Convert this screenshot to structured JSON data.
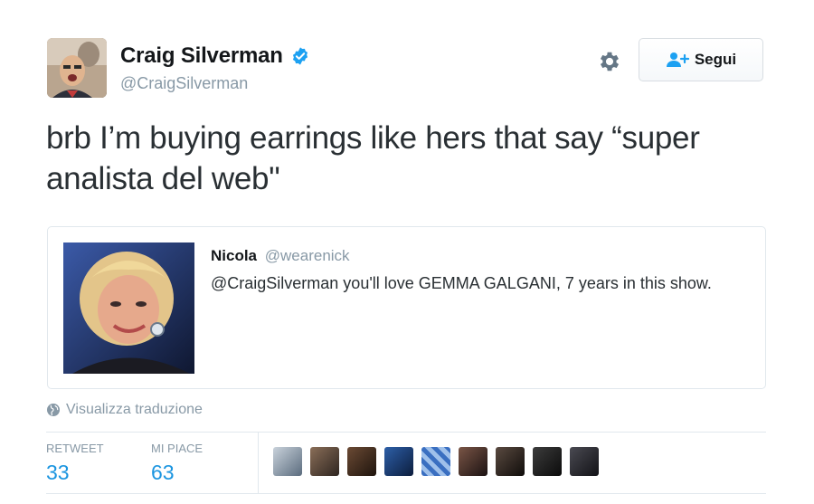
{
  "author": {
    "name": "Craig Silverman",
    "handle": "@CraigSilverman",
    "verified": true,
    "avatar_icon": "author-avatar"
  },
  "actions": {
    "settings_icon": "gear-icon",
    "follow_label": "Segui",
    "follow_icon": "person-add-icon"
  },
  "tweet": {
    "text": "brb I’m buying earrings like hers that say “super analista del web\""
  },
  "quote": {
    "name": "Nicola",
    "handle": "@wearenick",
    "text": "@CraigSilverman you'll love GEMMA GALGANI, 7 years in this show."
  },
  "translate": {
    "label": "Visualizza traduzione",
    "icon": "globe-icon"
  },
  "stats": {
    "retweet_label": "RETWEET",
    "retweet_count": "33",
    "like_label": "MI PIACE",
    "like_count": "63",
    "liker_count": 9
  },
  "colors": {
    "link_blue": "#1b95e0",
    "verified_blue": "#1da1f2",
    "muted_gray": "#8899a6",
    "border": "#e1e8ed"
  }
}
